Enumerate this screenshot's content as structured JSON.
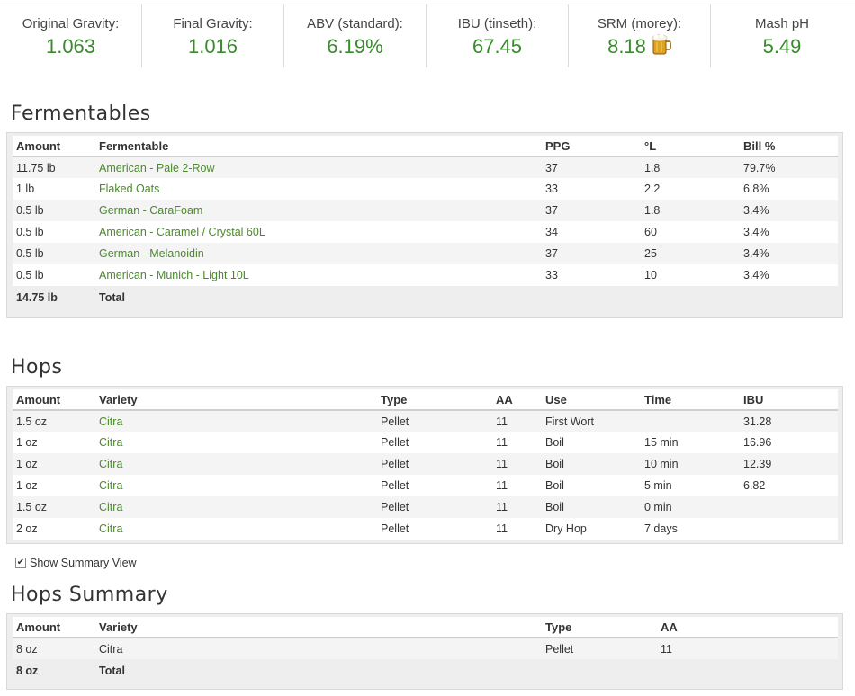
{
  "stats": [
    {
      "label": "Original Gravity:",
      "value": "1.063"
    },
    {
      "label": "Final Gravity:",
      "value": "1.016"
    },
    {
      "label": "ABV (standard):",
      "value": "6.19%"
    },
    {
      "label": "IBU (tinseth):",
      "value": "67.45"
    },
    {
      "label": "SRM (morey):",
      "value": "8.18"
    },
    {
      "label": "Mash pH",
      "value": "5.49"
    }
  ],
  "colors": {
    "accent_green": "#3a8a2e",
    "link_green": "#4a8a2a",
    "beer_amber": "#e0a020"
  },
  "icons": {
    "srm": "beer-mug-icon",
    "checkbox": "checkbox-checked-icon"
  },
  "fermentables": {
    "title": "Fermentables",
    "headers": [
      "Amount",
      "Fermentable",
      "PPG",
      "°L",
      "Bill %"
    ],
    "rows": [
      [
        "11.75 lb",
        "American - Pale 2-Row",
        "37",
        "1.8",
        "79.7%"
      ],
      [
        "1 lb",
        "Flaked Oats",
        "33",
        "2.2",
        "6.8%"
      ],
      [
        "0.5 lb",
        "German - CaraFoam",
        "37",
        "1.8",
        "3.4%"
      ],
      [
        "0.5 lb",
        "American - Caramel / Crystal 60L",
        "34",
        "60",
        "3.4%"
      ],
      [
        "0.5 lb",
        "German - Melanoidin",
        "37",
        "25",
        "3.4%"
      ],
      [
        "0.5 lb",
        "American - Munich - Light 10L",
        "33",
        "10",
        "3.4%"
      ]
    ],
    "total": [
      "14.75 lb",
      "Total"
    ]
  },
  "hops": {
    "title": "Hops",
    "headers": [
      "Amount",
      "Variety",
      "Type",
      "AA",
      "Use",
      "Time",
      "IBU"
    ],
    "rows": [
      [
        "1.5 oz",
        "Citra",
        "Pellet",
        "11",
        "First Wort",
        "",
        "31.28"
      ],
      [
        "1 oz",
        "Citra",
        "Pellet",
        "11",
        "Boil",
        "15 min",
        "16.96"
      ],
      [
        "1 oz",
        "Citra",
        "Pellet",
        "11",
        "Boil",
        "10 min",
        "12.39"
      ],
      [
        "1 oz",
        "Citra",
        "Pellet",
        "11",
        "Boil",
        "5 min",
        "6.82"
      ],
      [
        "1.5 oz",
        "Citra",
        "Pellet",
        "11",
        "Boil",
        "0 min",
        ""
      ],
      [
        "2 oz",
        "Citra",
        "Pellet",
        "11",
        "Dry Hop",
        "7 days",
        ""
      ]
    ]
  },
  "summary_toggle": {
    "label": "Show Summary View",
    "checked": true
  },
  "hops_summary": {
    "title": "Hops Summary",
    "headers": [
      "Amount",
      "Variety",
      "Type",
      "AA"
    ],
    "rows": [
      [
        "8 oz",
        "Citra",
        "Pellet",
        "11"
      ]
    ],
    "total": [
      "8 oz",
      "Total"
    ]
  }
}
